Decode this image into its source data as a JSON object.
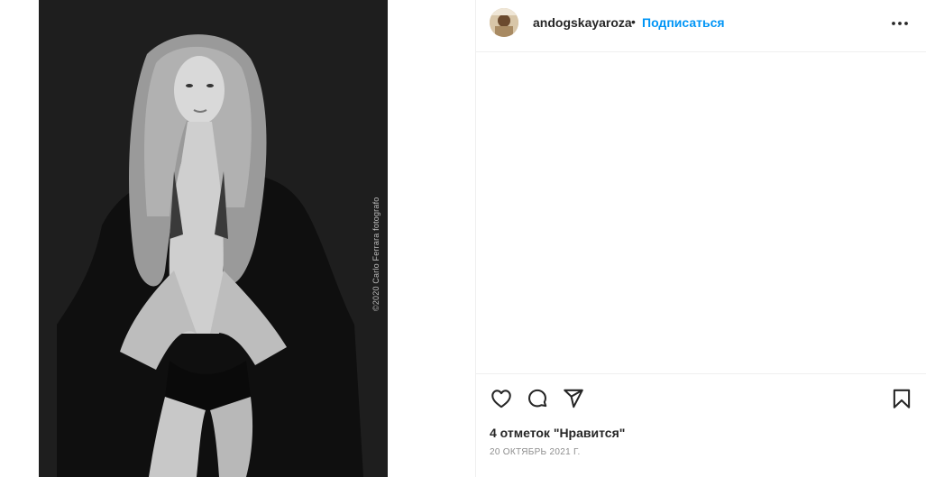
{
  "post": {
    "watermark": "©2020 Carlo Ferrara fotografo"
  },
  "header": {
    "username": "andogskayaroza",
    "separator": "•",
    "follow_label": "Подписаться"
  },
  "footer": {
    "likes_text": "4 отметок \"Нравится\"",
    "date_text": "20 ОКТЯБРЬ 2021 Г."
  },
  "icons": {
    "like": "heart-icon",
    "comment": "comment-icon",
    "share": "paper-plane-icon",
    "save": "bookmark-icon",
    "more": "more-options-icon"
  },
  "colors": {
    "accent": "#0095f6",
    "text": "#262626",
    "muted": "#8e8e8e",
    "border": "#efefef",
    "photo_bg": "#1e1e1e"
  }
}
